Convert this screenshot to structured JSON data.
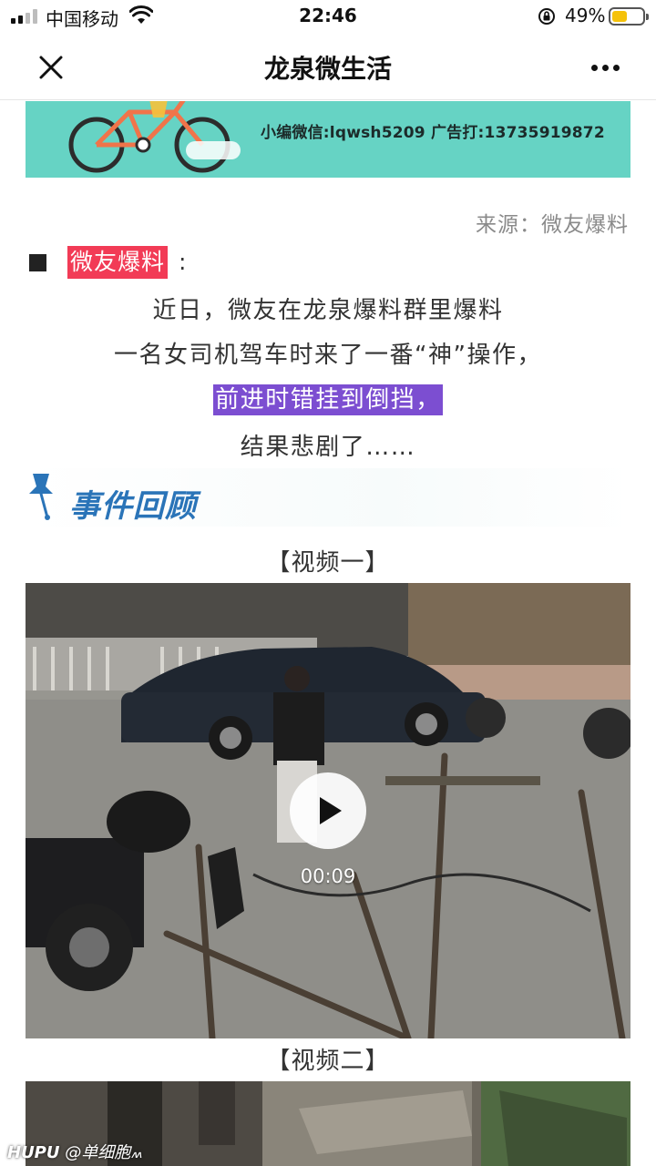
{
  "status_bar": {
    "carrier": "中国移动",
    "time": "22:46",
    "battery_percent": "49%",
    "battery_level": 0.49,
    "battery_color": "#f5c20a"
  },
  "nav": {
    "title": "龙泉微生活",
    "close_icon": "close-icon",
    "more_icon": "more-icon"
  },
  "banner": {
    "text": "小编微信:lqwsh5209  广告打:13735919872",
    "bg_color": "#66d3c4"
  },
  "article": {
    "source": "来源：微友爆料",
    "tag": "微友爆料",
    "tag_colon": ":",
    "tag_color": "#f23b56",
    "lines": [
      "近日，微友在龙泉爆料群里爆料",
      "一名女司机驾车时来了一番“神”操作，",
      "前进时错挂到倒挡，",
      "结果悲剧了……"
    ],
    "highlight_color": "#7c4ed1",
    "section_title": "事件回顾",
    "section_color": "#2a74b8"
  },
  "videos": [
    {
      "label": "【视频一】",
      "duration": "00:09"
    },
    {
      "label": "【视频二】"
    }
  ],
  "watermark": {
    "brand": "HUPU",
    "user": "@单细胞៳"
  }
}
